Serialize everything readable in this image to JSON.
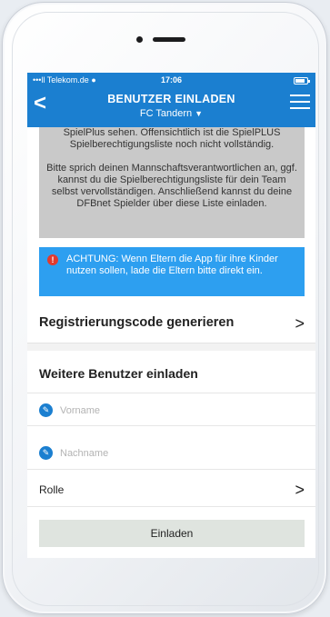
{
  "status_bar": {
    "carrier": "•••ll Telekom.de ●",
    "time": "17:06",
    "battery_level": 0.8
  },
  "nav": {
    "back_label": "<",
    "title": "BENUTZER EINLADEN",
    "subtitle": "FC Tandern",
    "subtitle_icon": "chevron-down-icon",
    "menu_icon": "hamburger-menu-icon"
  },
  "info_box": {
    "paragraph1": "SpielPlus sehen. Offensichtlich ist die SpielPLUS Spielberechtigungsliste noch nicht vollständig.",
    "paragraph2": "Bitte sprich deinen Mannschaftsverantwortlichen an, ggf. kannst du die Spielberechtigungsliste für dein Team selbst vervollständigen. Anschließend kannst du deine DFBnet Spielder über diese Liste einladen."
  },
  "alert": {
    "icon": "!",
    "text": "ACHTUNG: Wenn Eltern die App für ihre Kinder  nutzen sollen, lade die Eltern bitte direkt ein."
  },
  "registration": {
    "label": "Registrierungscode generieren",
    "chevron": ">"
  },
  "invite": {
    "heading": "Weitere Benutzer einladen",
    "first_name_placeholder": "Vorname",
    "first_name_value": "",
    "last_name_placeholder": "Nachname",
    "last_name_value": "",
    "role_label": "Rolle",
    "role_chevron": ">",
    "submit_label": "Einladen"
  },
  "colors": {
    "nav_bar": "#1b7fd0",
    "alert_bg": "#2d9ff0",
    "info_bg": "#c9c9c9",
    "warning_icon": "#e23a2e",
    "button_bg": "#dfe4df"
  }
}
